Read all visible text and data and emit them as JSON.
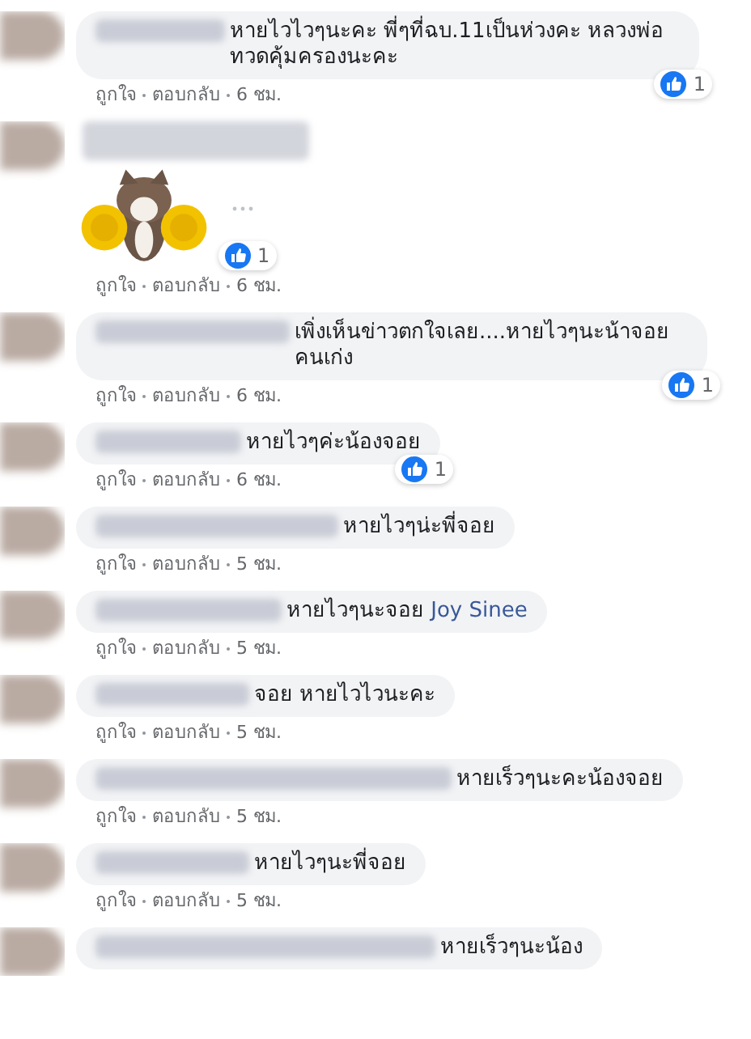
{
  "comments": [
    {
      "kind": "text",
      "text": "หายไวไวๆนะคะ พี่ๆที่ฉบ.11เป็นห่วงคะ หลวงพ่อทวดคุ้มครองนะคะ",
      "like_count": "1",
      "actions": [
        "ถูกใจ",
        "ตอบกลับ",
        "6 ชม."
      ]
    },
    {
      "kind": "sticker",
      "like_count": "1",
      "actions": [
        "ถูกใจ",
        "ตอบกลับ",
        "6 ชม."
      ]
    },
    {
      "kind": "text",
      "text": "เพิ่งเห็นข่าวตกใจเลย....หายไวๆนะน้าจอยคนเก่ง",
      "like_count": "1",
      "actions": [
        "ถูกใจ",
        "ตอบกลับ",
        "6 ชม."
      ]
    },
    {
      "kind": "text",
      "text": "หายไวๆค่ะน้องจอย",
      "like_count": "1",
      "actions": [
        "ถูกใจ",
        "ตอบกลับ",
        "6 ชม."
      ]
    },
    {
      "kind": "text",
      "text": "หายไวๆน่ะพี่จอย",
      "actions": [
        "ถูกใจ",
        "ตอบกลับ",
        "5 ชม."
      ]
    },
    {
      "kind": "text",
      "text": "หายไวๆนะจอย",
      "mention": "Joy Sinee",
      "actions": [
        "ถูกใจ",
        "ตอบกลับ",
        "5 ชม."
      ]
    },
    {
      "kind": "text",
      "text": "จอย หายไวไวนะคะ",
      "actions": [
        "ถูกใจ",
        "ตอบกลับ",
        "5 ชม."
      ]
    },
    {
      "kind": "text",
      "text": "หายเร็วๆนะคะน้องจอย",
      "actions": [
        "ถูกใจ",
        "ตอบกลับ",
        "5 ชม."
      ]
    },
    {
      "kind": "text",
      "text": "หายไวๆนะพี่จอย",
      "actions": [
        "ถูกใจ",
        "ตอบกลับ",
        "5 ชม."
      ]
    },
    {
      "kind": "text",
      "text": "หายเร็วๆนะน้อง"
    }
  ]
}
